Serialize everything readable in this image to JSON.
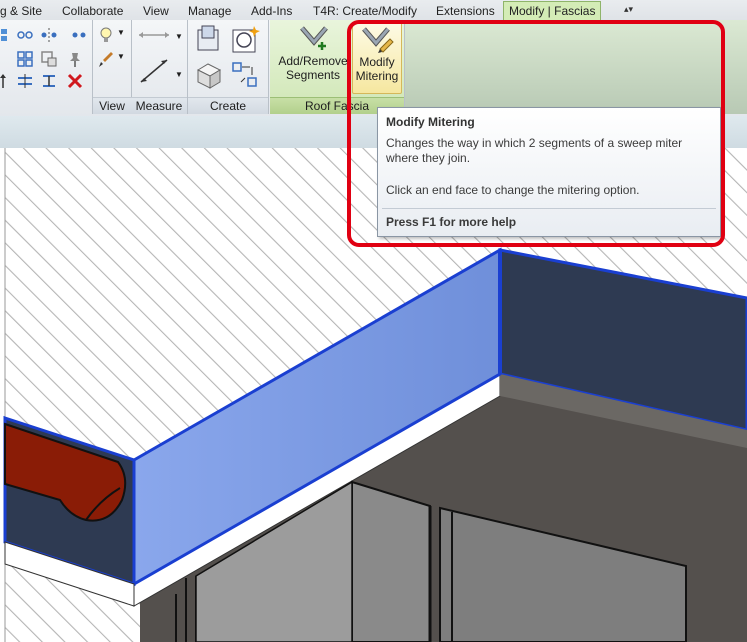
{
  "tabs": [
    {
      "label": "g & Site",
      "active": false
    },
    {
      "label": "Collaborate",
      "active": false
    },
    {
      "label": "View",
      "active": false
    },
    {
      "label": "Manage",
      "active": false
    },
    {
      "label": "Add-Ins",
      "active": false
    },
    {
      "label": "T4R: Create/Modify",
      "active": false
    },
    {
      "label": "Extensions",
      "active": false
    },
    {
      "label": "Modify | Fascias",
      "active": true
    }
  ],
  "quick_access": {
    "glyph": "▴▾"
  },
  "panels": {
    "view": {
      "label": "View"
    },
    "measure": {
      "label": "Measure"
    },
    "create": {
      "label": "Create"
    },
    "roof_fascia": {
      "label": "Roof Fascia",
      "add_remove": {
        "line1": "Add/Remove",
        "line2": "Segments"
      },
      "modify_mitering": {
        "line1": "Modify",
        "line2": "Mitering"
      }
    }
  },
  "tooltip": {
    "title": "Modify Mitering",
    "description": "Changes the way in which 2 segments of a sweep miter where they join.",
    "hint": "Click an end face to change the mitering option.",
    "help": "Press F1 for more help"
  },
  "colors": {
    "highlight": "#e00012",
    "fascia_selected": "#7b9ae0",
    "selection_edge": "#1a3fd1",
    "wall_dark": "#2e3a52",
    "gutter": "#8a1c06",
    "context_tab": "#d4ecb6"
  }
}
